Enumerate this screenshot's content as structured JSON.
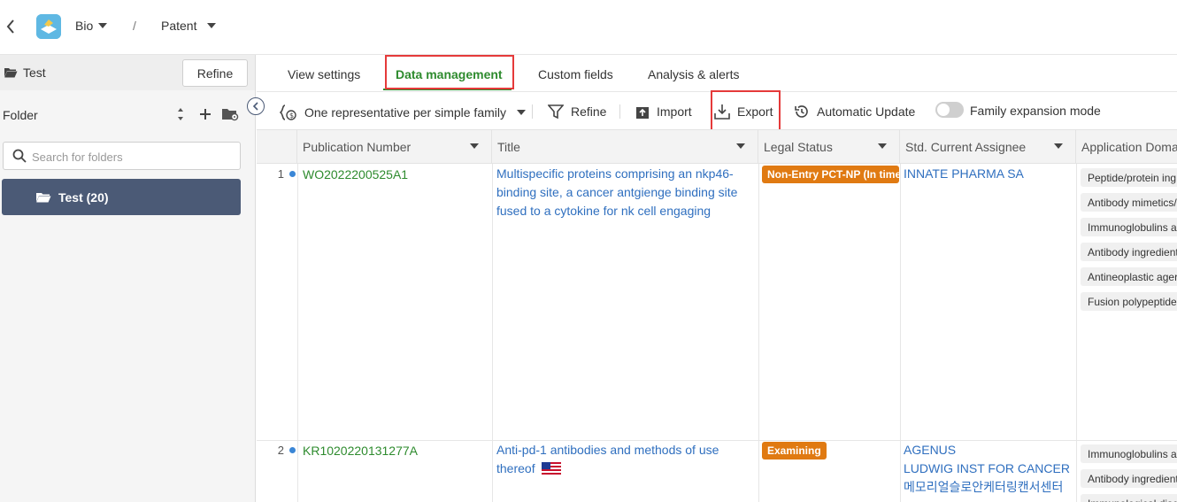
{
  "header": {
    "breadcrumb": [
      {
        "label": "Bio"
      },
      {
        "label": "/"
      },
      {
        "label": "Patent"
      }
    ]
  },
  "sidebar": {
    "title": "Test",
    "refine_label": "Refine",
    "folder_label": "Folder",
    "search_placeholder": "Search for folders",
    "folders": [
      {
        "label": "Test (20)"
      }
    ]
  },
  "tabs": [
    {
      "label": "View settings"
    },
    {
      "label": "Data management",
      "active": true
    },
    {
      "label": "Custom fields"
    },
    {
      "label": "Analysis & alerts"
    }
  ],
  "toolbar": {
    "family_mode": "One representative per simple family",
    "refine": "Refine",
    "import": "Import",
    "export": "Export",
    "auto_update": "Automatic Update",
    "family_expansion": "Family expansion mode",
    "family_expansion_on": false
  },
  "table": {
    "columns": [
      "Publication Number",
      "Title",
      "Legal Status",
      "Std. Current Assignee",
      "Application Doma"
    ],
    "rows": [
      {
        "num": "1",
        "pub": "WO2022200525A1",
        "title": "Multispecific proteins comprising an nkp46-binding site, a cancer antgienge binding site fused to a cytokine for nk cell engaging",
        "status": "Non-Entry PCT-NP (In time",
        "assignees": [
          "INNATE PHARMA SA"
        ],
        "domains": [
          "Peptide/protein ing",
          "Antibody mimetics/",
          "Immunoglobulins a",
          "Antibody ingredient",
          "Antineoplastic ager",
          "Fusion polypeptide"
        ]
      },
      {
        "num": "2",
        "pub": "KR1020220131277A",
        "title": "Anti-pd-1 antibodies and methods of use thereof",
        "status": "Examining",
        "assignees": [
          "AGENUS",
          "LUDWIG INST FOR CANCER",
          "메모리얼슬로안케터링캔서센터"
        ],
        "domains": [
          "Immunoglobulins a",
          "Antibody ingredient",
          "Immunological disc"
        ]
      }
    ]
  },
  "colors": {
    "accent_green": "#2e8b2e",
    "link_blue": "#2f6fbf",
    "status_orange": "#e07a12",
    "folder_selected": "#4b5a76",
    "highlight_red": "#e53a3a"
  }
}
